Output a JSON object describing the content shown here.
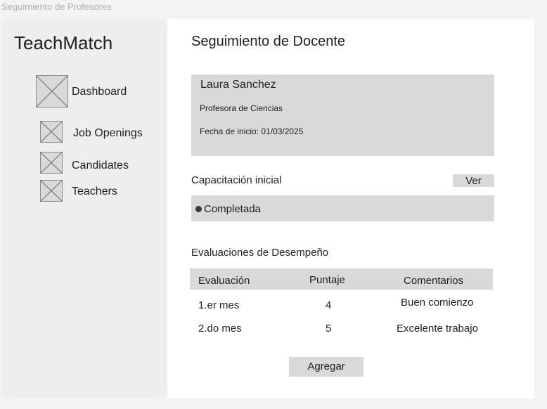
{
  "window": {
    "title": "Seguimiento de Profesores"
  },
  "sidebar": {
    "brand": "TeachMatch",
    "items": [
      {
        "label": "Dashboard",
        "icon": "image-placeholder-icon"
      },
      {
        "label": "Job Openings",
        "icon": "image-placeholder-icon"
      },
      {
        "label": "Candidates",
        "icon": "image-placeholder-icon"
      },
      {
        "label": "Teachers",
        "icon": "image-placeholder-icon"
      }
    ]
  },
  "main": {
    "title": "Seguimiento de Docente",
    "profile": {
      "name": "Laura Sanchez",
      "role": "Profesora de Ciencias",
      "start_date": "Fecha de inicio: 01/03/2025"
    },
    "training": {
      "heading": "Capacitación inicial",
      "view_button": "Ver",
      "status": "Completada"
    },
    "evaluations": {
      "heading": "Evaluaciones de Desempeño",
      "columns": [
        "Evaluación",
        "Puntaje",
        "Comentarios"
      ],
      "rows": [
        [
          "1.er mes",
          "4",
          "Buen comienzo"
        ],
        [
          "2.do mes",
          "5",
          "Excelente trabajo"
        ]
      ],
      "add_button": "Agregar"
    }
  },
  "colors": {
    "background": "#f3f3f3",
    "sidebar": "#eeeeee",
    "panel": "#d9d9d9",
    "text": "#1e1e1e"
  }
}
